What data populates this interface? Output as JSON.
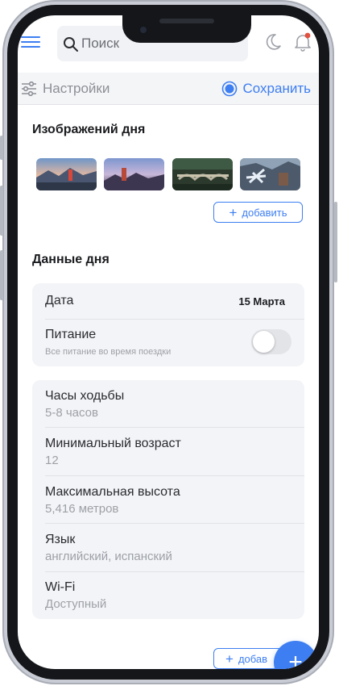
{
  "header": {
    "search_placeholder": "Поиск"
  },
  "toolbar": {
    "settings_label": "Настройки",
    "save_label": "Сохранить"
  },
  "images_section": {
    "title": "Изображений дня",
    "add_label": "добавить"
  },
  "day_data": {
    "title": "Данные дня",
    "date_label": "Дата",
    "date_value": "15 Марта",
    "food_label": "Питание",
    "food_hint": "Все питание во время поездки",
    "food_enabled": false
  },
  "details": [
    {
      "label": "Часы ходьбы",
      "value": "5-8 часов"
    },
    {
      "label": "Минимальный возраст",
      "value": "12"
    },
    {
      "label": "Максимальная высота",
      "value": "5,416 метров"
    },
    {
      "label": "Язык",
      "value": "английский, испанский"
    },
    {
      "label": "Wi-Fi",
      "value": "Доступный"
    }
  ],
  "bottom": {
    "add_label": "добав"
  },
  "colors": {
    "accent": "#3d7ef2",
    "notification_dot": "#e2503f"
  }
}
